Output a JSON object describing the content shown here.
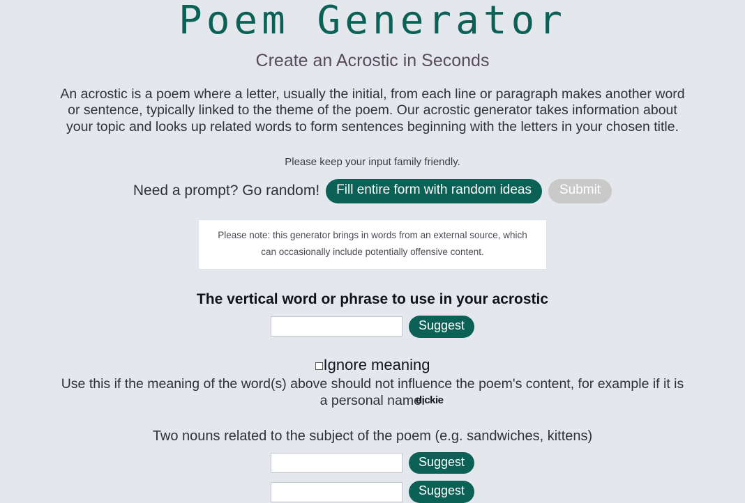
{
  "header": {
    "title": "Poem Generator",
    "subtitle": "Create an Acrostic in Seconds",
    "intro": "An acrostic is a poem where a letter, usually the initial, from each line or paragraph makes another word or sentence, typically linked to the theme of the poem. Our acrostic generator takes information about your topic and looks up related words to form sentences beginning with the letters in your chosen title."
  },
  "notices": {
    "family_friendly": "Please keep your input family friendly.",
    "external_source_note": "Please note: this generator brings in words from an external source, which can occasionally include potentially offensive content."
  },
  "prompt": {
    "label": "Need a prompt? Go random!",
    "random_button": "Fill entire form with random ideas",
    "submit_button": "Submit"
  },
  "form": {
    "vertical_word": {
      "label": "The vertical word or phrase to use in your acrostic",
      "value": "",
      "suggest_label": "Suggest"
    },
    "ignore_meaning": {
      "label": "Ignore meaning",
      "checked": false,
      "help": "Use this if the meaning of the word(s) above should not influence the poem's content, for example if it is a personal name.",
      "overlap_text": "dickie"
    },
    "nouns": {
      "label": "Two nouns related to the subject of the poem (e.g. sandwiches, kittens)",
      "fields": [
        {
          "value": "",
          "suggest_label": "Suggest"
        },
        {
          "value": "",
          "suggest_label": "Suggest"
        }
      ]
    }
  },
  "colors": {
    "background": "#e4e8ed",
    "accent_teal": "#0c6157",
    "disabled_grey": "#c9c9c9",
    "subtitle": "#574a5c"
  }
}
